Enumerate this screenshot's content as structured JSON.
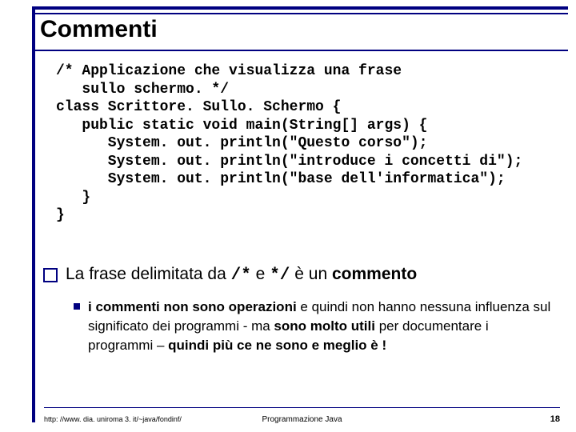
{
  "title": "Commenti",
  "code": "/* Applicazione che visualizza una frase\n   sullo schermo. */\nclass Scrittore. Sullo. Schermo {\n   public static void main(String[] args) {\n      System. out. println(\"Questo corso\");\n      System. out. println(\"introduce i concetti di\");\n      System. out. println(\"base dell'informatica\");\n   }\n}",
  "bullet": {
    "pre": "La frase delimitata da ",
    "tok1": "/*",
    "mid": " e ",
    "tok2": "*/",
    "post": " è un ",
    "strong": "commento"
  },
  "sub": {
    "s1": "i commenti non sono operazioni",
    "p1": " e quindi non hanno nessuna influenza sul significato dei programmi - ma ",
    "s2": "sono molto utili",
    "p2": " per documentare i programmi – ",
    "s3": "quindi più ce ne sono e meglio è !"
  },
  "footer": {
    "left": "http: //www. dia. uniroma 3. it/~java/fondinf/",
    "center": "Programmazione Java",
    "right": "18"
  }
}
